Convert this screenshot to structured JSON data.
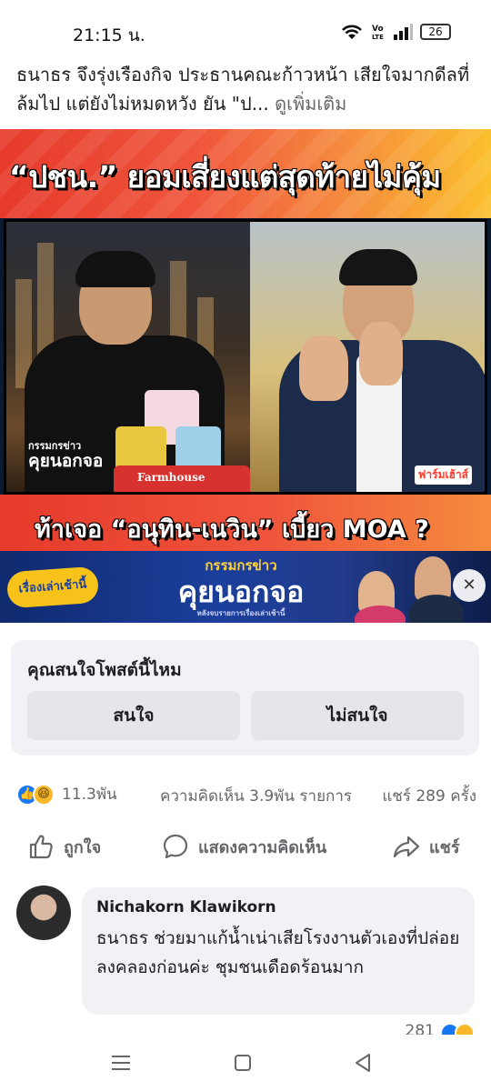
{
  "status_bar": {
    "time": "21:15 น.",
    "battery": "26",
    "icons": [
      "wifi-icon",
      "volte-icon",
      "signal-icon",
      "battery-icon"
    ]
  },
  "post": {
    "caption": "ธนาธร จึงรุ่งเรืองกิจ ประธานคณะก้าวหน้า เสียใจมากดีลที่ล้มไป แต่ยังไม่หมดหวัง ยัน \"ป...",
    "see_more": "ดูเพิ่มเติม"
  },
  "media": {
    "headline_top": "“ปชน.” ยอมเสี่ยงแต่สุดท้ายไม่คุ้ม",
    "headline_bottom": "ท้าเจอ “อนุทิน-เนวิน” เบี้ยว MOA ?",
    "show_logo_small": "กรรมกรข่าว",
    "show_logo_big": "คุยนอกจอ",
    "farmhouse_label": "Farmhouse",
    "sponsor_label": "ฟาร์มเฮ้าส์",
    "promo": {
      "left_label": "เรื่องเล่าเช้านี้",
      "title_small": "กรรมกรข่าว",
      "title_big": "คุยนอกจอ",
      "subtitle": "หลังจบรายการเรื่องเล่าเช้านี้",
      "close_symbol": "✕"
    }
  },
  "interest": {
    "question": "คุณสนใจโพสต์นี้ไหม",
    "yes_label": "สนใจ",
    "no_label": "ไม่สนใจ"
  },
  "stats": {
    "reaction_count": "11.3พัน",
    "comments": "ความคิดเห็น 3.9พัน รายการ",
    "shares": "แชร์ 289 ครั้ง"
  },
  "actions": {
    "like": "ถูกใจ",
    "comment": "แสดงความคิดเห็น",
    "share": "แชร์"
  },
  "comment": {
    "author": "Nichakorn Klawikorn",
    "text": "ธนาธร ช่วยมาแก้น้ำเน่าเสียโรงงานตัวเองที่ปล่อยลงคลองก่อนค่ะ ชุมชนเดือดร้อนมาก",
    "partial_count": "281"
  },
  "colors": {
    "accent": "#1877f2",
    "banner_red": "#e63a2b",
    "bubble": "#f0f2f5",
    "muted_text": "#65676b"
  }
}
